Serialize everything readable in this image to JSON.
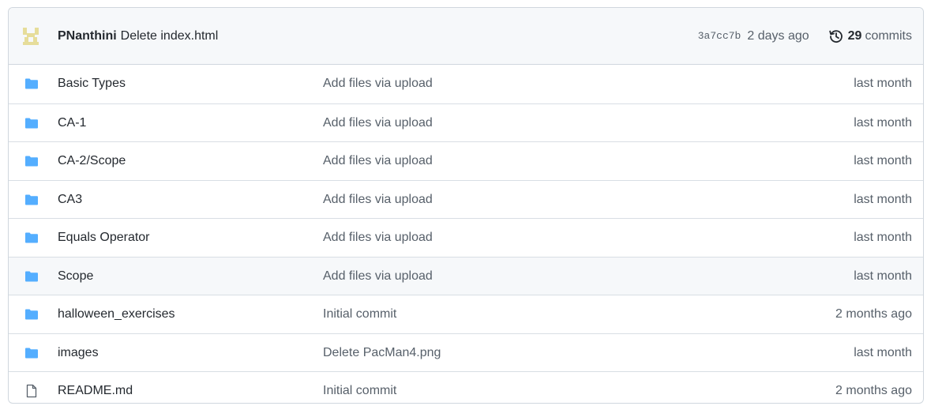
{
  "latest_commit": {
    "author": "PNanthini",
    "message": "Delete index.html",
    "sha": "3a7cc7b",
    "age": "2 days ago",
    "commits_count": "29",
    "commits_label": "commits",
    "avatar_icon": "identicon-avatar",
    "history_icon": "history-icon"
  },
  "files": [
    {
      "type": "folder",
      "name": "Basic Types",
      "commit": "Add files via upload",
      "age": "last month"
    },
    {
      "type": "folder",
      "name": "CA-1",
      "commit": "Add files via upload",
      "age": "last month"
    },
    {
      "type": "folder",
      "name": "CA-2/Scope",
      "commit": "Add files via upload",
      "age": "last month"
    },
    {
      "type": "folder",
      "name": "CA3",
      "commit": "Add files via upload",
      "age": "last month"
    },
    {
      "type": "folder",
      "name": "Equals Operator",
      "commit": "Add files via upload",
      "age": "last month"
    },
    {
      "type": "folder",
      "name": "Scope",
      "commit": "Add files via upload",
      "age": "last month"
    },
    {
      "type": "folder",
      "name": "halloween_exercises",
      "commit": "Initial commit",
      "age": "2 months ago"
    },
    {
      "type": "folder",
      "name": "images",
      "commit": "Delete PacMan4.png",
      "age": "last month"
    },
    {
      "type": "file",
      "name": "README.md",
      "commit": "Initial commit",
      "age": "2 months ago"
    }
  ],
  "colors": {
    "folder": "#54aeff",
    "header_bg": "#f6f8fa",
    "border": "#d0d7de",
    "muted_text": "#57606a",
    "avatar": "#e8e0a0"
  }
}
